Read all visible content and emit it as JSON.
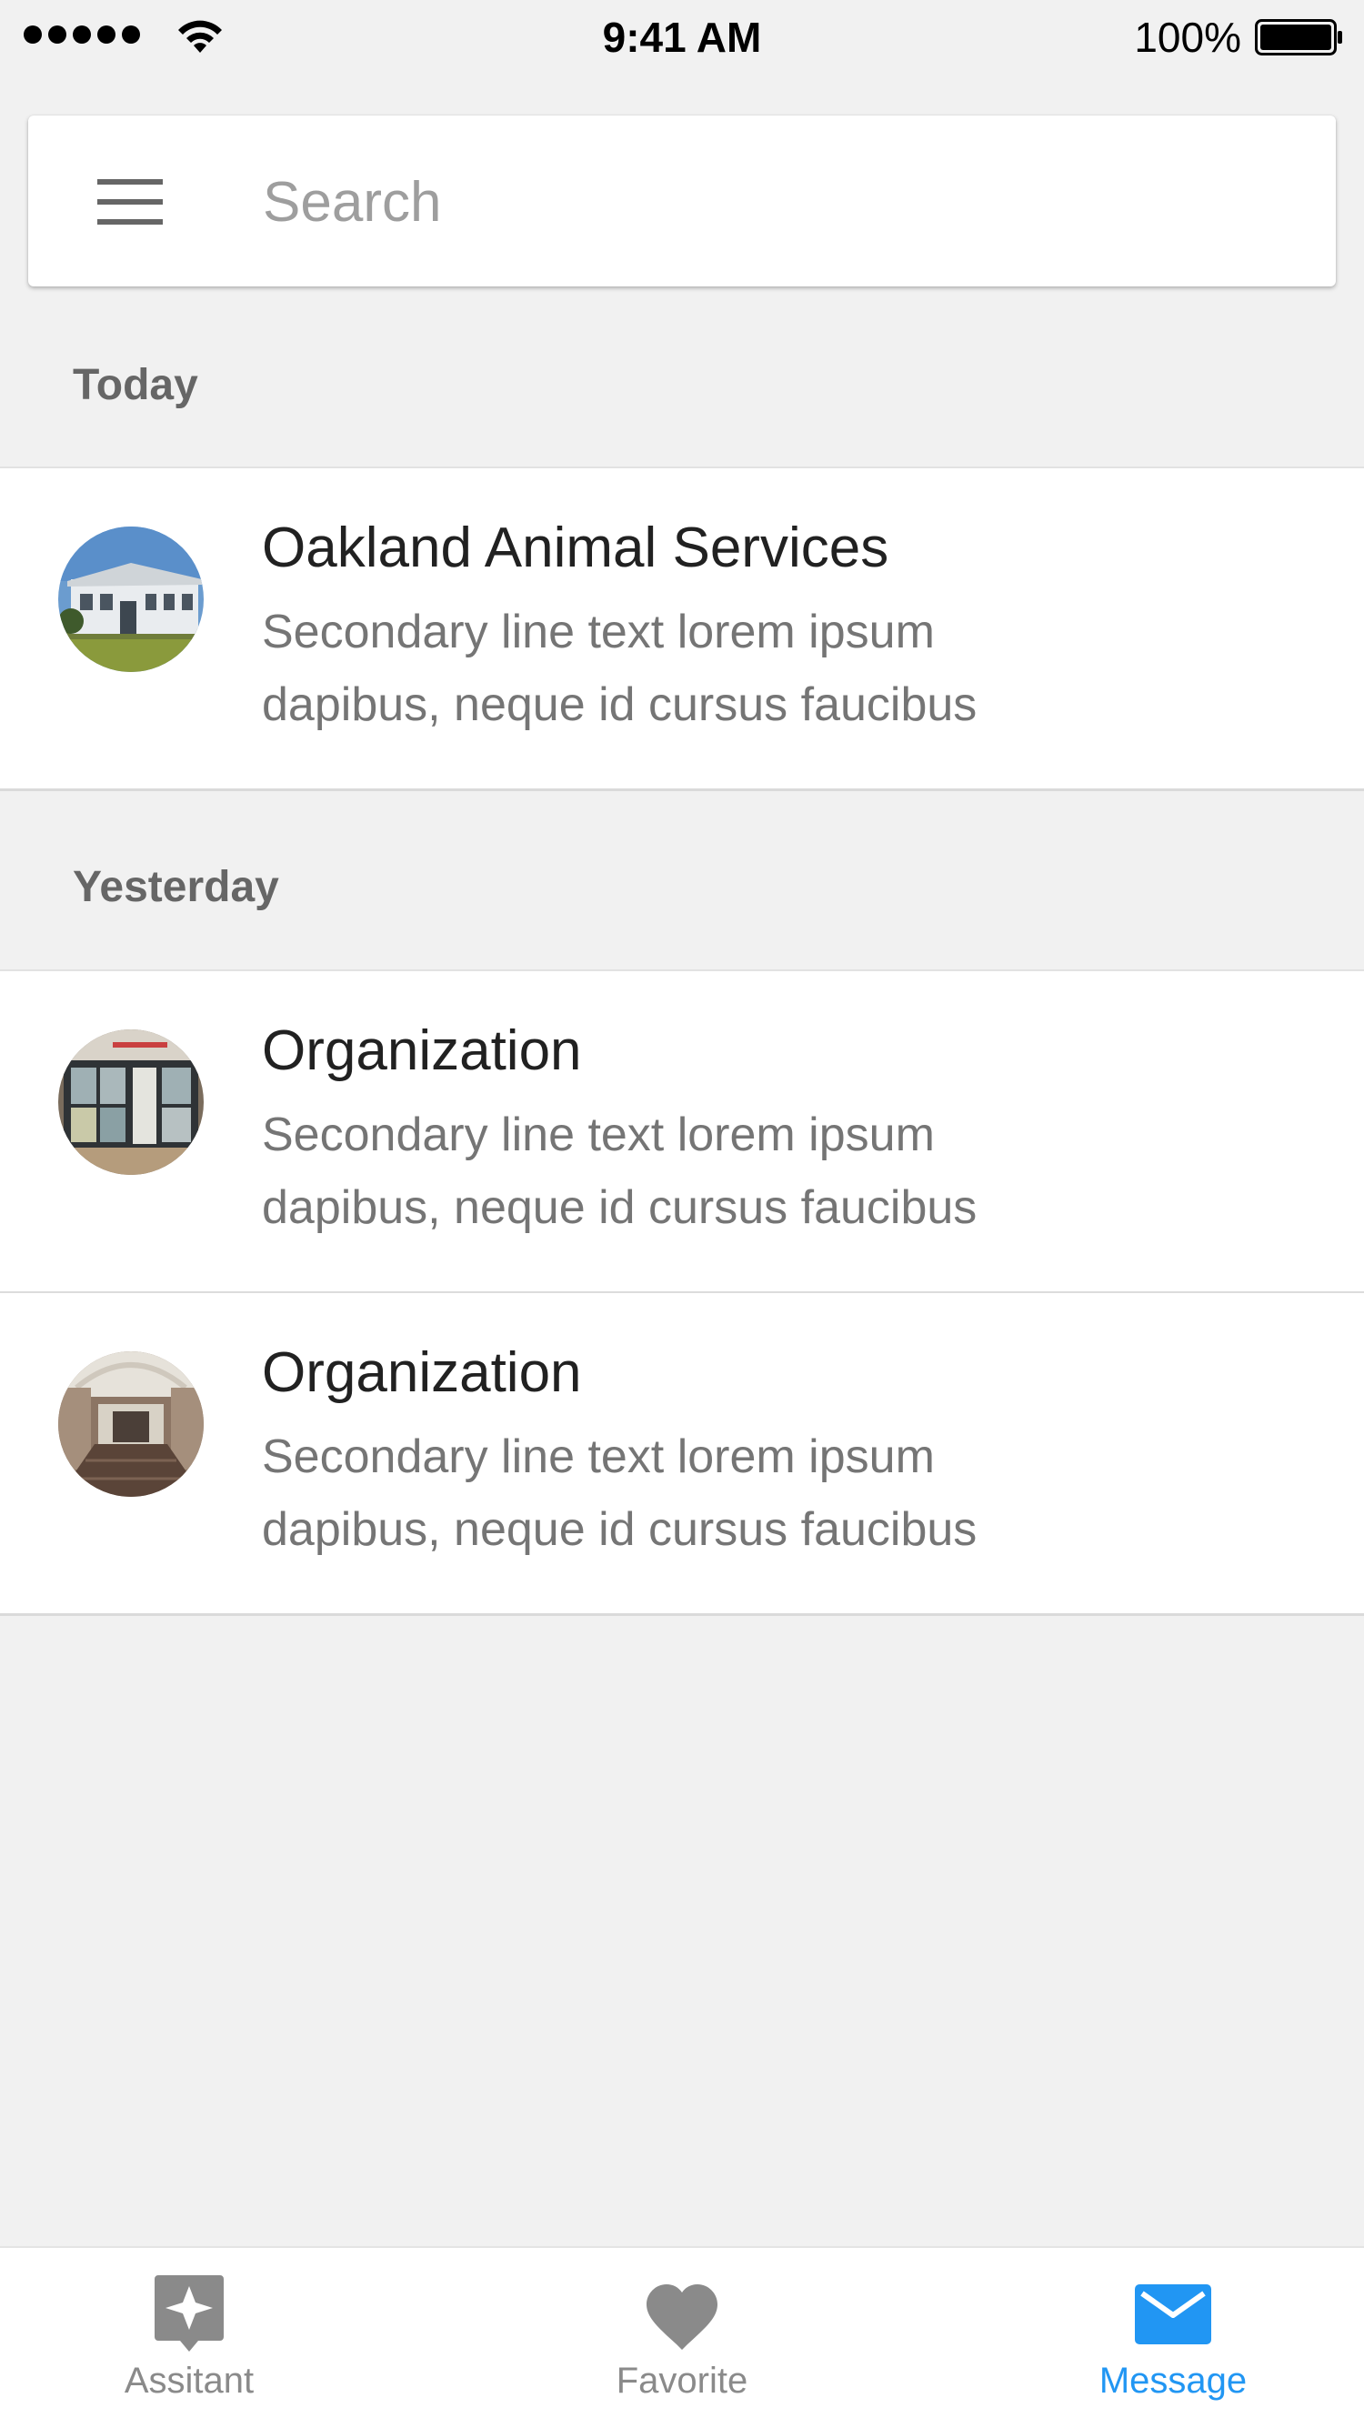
{
  "status_bar": {
    "time": "9:41 AM",
    "battery": "100%"
  },
  "search": {
    "placeholder": "Search"
  },
  "sections": [
    {
      "header": "Today",
      "items": [
        {
          "title": "Oakland Animal Services",
          "subtitle": "Secondary line text lorem ipsum dapibus, neque id cursus faucibus",
          "avatar": "building-photo"
        }
      ]
    },
    {
      "header": "Yesterday",
      "items": [
        {
          "title": "Organization",
          "subtitle": "Secondary line text lorem ipsum dapibus, neque id cursus faucibus",
          "avatar": "storefront-photo"
        },
        {
          "title": "Organization",
          "subtitle": "Secondary line text lorem ipsum dapibus, neque id cursus faucibus",
          "avatar": "hallway-photo"
        }
      ]
    }
  ],
  "tab_bar": {
    "active_color": "#2196f3",
    "tabs": [
      {
        "label": "Assitant",
        "icon": "assistant-icon",
        "active": false
      },
      {
        "label": "Favorite",
        "icon": "heart-icon",
        "active": false
      },
      {
        "label": "Message",
        "icon": "mail-icon",
        "active": true
      }
    ]
  }
}
